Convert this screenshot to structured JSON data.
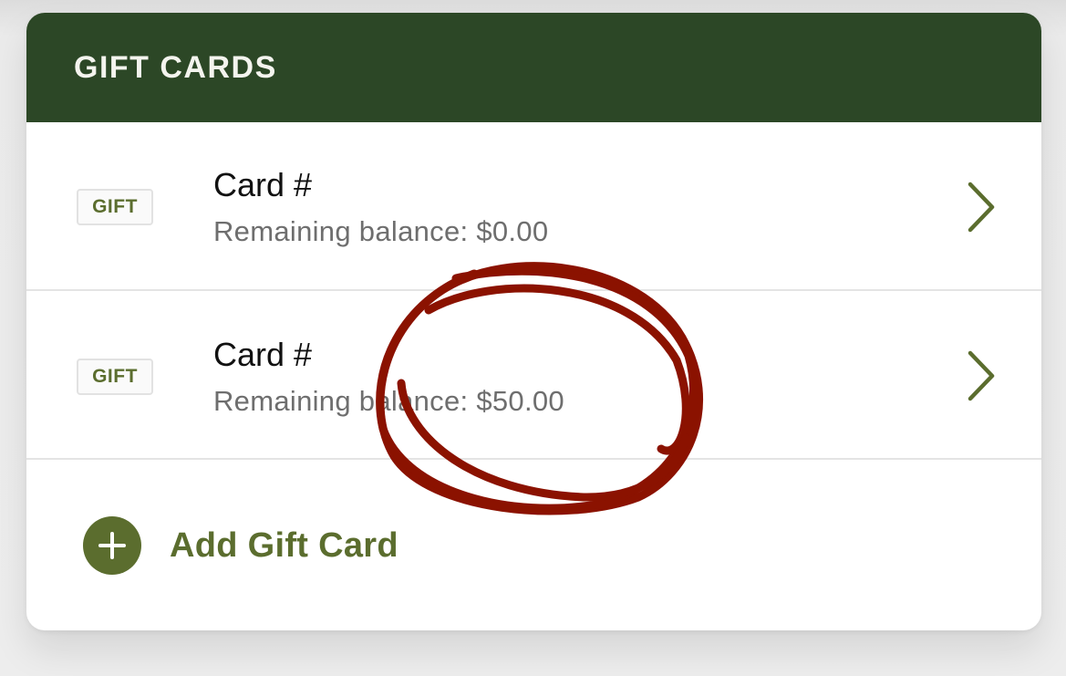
{
  "header": {
    "title": "GIFT CARDS"
  },
  "cards": [
    {
      "badge": "GIFT",
      "title": "Card #",
      "balance": "Remaining balance: $0.00",
      "chevron_icon": "chevron-right-icon"
    },
    {
      "badge": "GIFT",
      "title": "Card #",
      "balance": "Remaining balance: $50.00",
      "chevron_icon": "chevron-right-icon"
    }
  ],
  "add": {
    "label": "Add Gift Card",
    "icon": "plus-circle-icon"
  },
  "colors": {
    "header_bg": "#2c4726",
    "accent": "#5b6d2e",
    "annotation": "#8b1200"
  }
}
